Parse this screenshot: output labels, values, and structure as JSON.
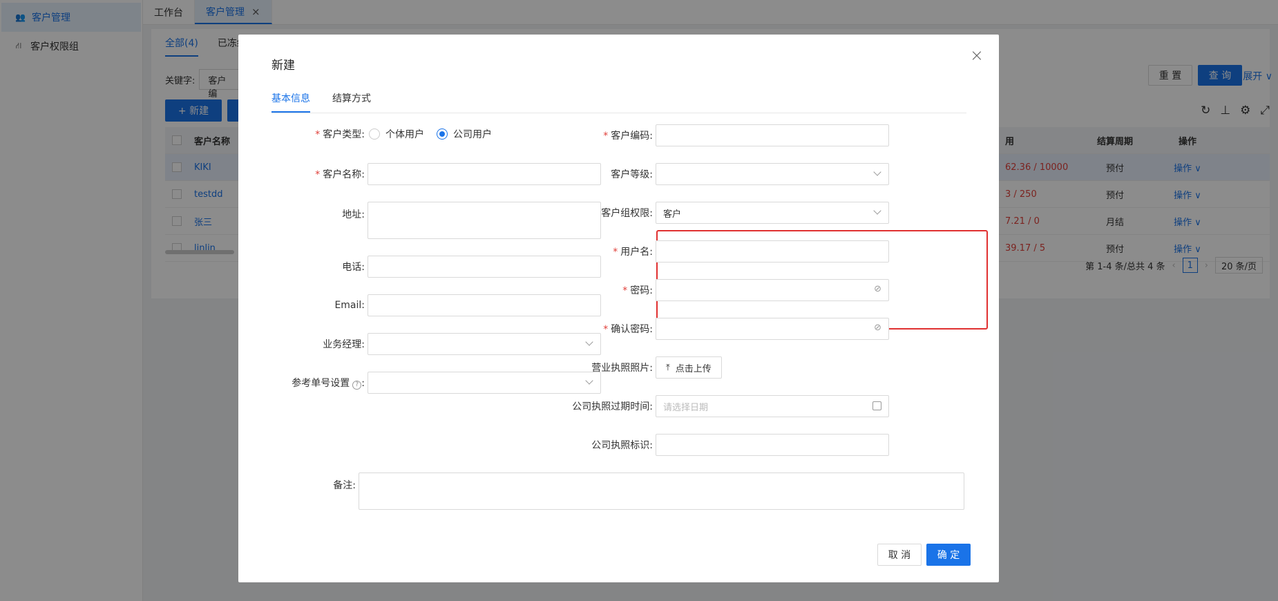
{
  "sidebar": {
    "items": [
      {
        "label": "客户管理",
        "icon": "users-icon",
        "active": true
      },
      {
        "label": "客户权限组",
        "icon": "org-tree-icon",
        "active": false
      }
    ]
  },
  "tabs": [
    {
      "label": "工作台"
    },
    {
      "label": "客户管理",
      "close": "×"
    }
  ],
  "page": {
    "subtabs": [
      "全部(4)",
      "已冻结"
    ],
    "keyword_label": "关键字:",
    "keyword_placeholder": "客户编",
    "reset": "重 置",
    "query": "查 询",
    "expand": "展开 ∨",
    "new_button": "+ 新建",
    "table": {
      "headers": {
        "name": "客户名称",
        "used": "用",
        "cycle": "结算周期",
        "op": "操作"
      },
      "rows": [
        {
          "name": "KIKI",
          "used": "62.36 / 10000",
          "cycle": "预付",
          "op": "操作 ∨"
        },
        {
          "name": "testdd",
          "used": "3 / 250",
          "cycle": "预付",
          "op": "操作 ∨"
        },
        {
          "name": "张三",
          "used": "7.21 / 0",
          "cycle": "月结",
          "op": "操作 ∨"
        },
        {
          "name": "linlin",
          "used": "39.17 / 5",
          "cycle": "预付",
          "op": "操作 ∨"
        }
      ]
    },
    "pager": {
      "summary": "第 1-4 条/总共 4 条",
      "current": "1",
      "page_size": "20 条/页"
    }
  },
  "modal": {
    "title": "新建",
    "close": "×",
    "tabs": [
      "基本信息",
      "结算方式"
    ],
    "left": {
      "customer_type": {
        "label": "客户类型:",
        "options": [
          "个体用户",
          "公司用户"
        ],
        "selected": "公司用户"
      },
      "customer_name": {
        "label": "客户名称:"
      },
      "address": {
        "label": "地址:"
      },
      "phone": {
        "label": "电话:"
      },
      "email": {
        "label": "Email:"
      },
      "manager": {
        "label": "业务经理:"
      },
      "ref_no": {
        "label": "参考单号设置"
      }
    },
    "right": {
      "customer_code": {
        "label": "客户编码:"
      },
      "customer_level": {
        "label": "客户等级:"
      },
      "group_permission": {
        "label": "客户组权限:",
        "value": "客户"
      },
      "username": {
        "label": "用户名:"
      },
      "password": {
        "label": "密码:"
      },
      "confirm_password": {
        "label": "确认密码:"
      },
      "license_photo": {
        "label": "营业执照照片:",
        "button": "点击上传"
      },
      "license_expiry": {
        "label": "公司执照过期时间:",
        "placeholder": "请选择日期"
      },
      "license_id": {
        "label": "公司执照标识:"
      }
    },
    "remark": {
      "label": "备注:"
    },
    "cancel": "取 消",
    "ok": "确 定"
  },
  "colors": {
    "primary": "#1a73e8",
    "required": "#e0403a",
    "highlight_border": "#e03030"
  }
}
